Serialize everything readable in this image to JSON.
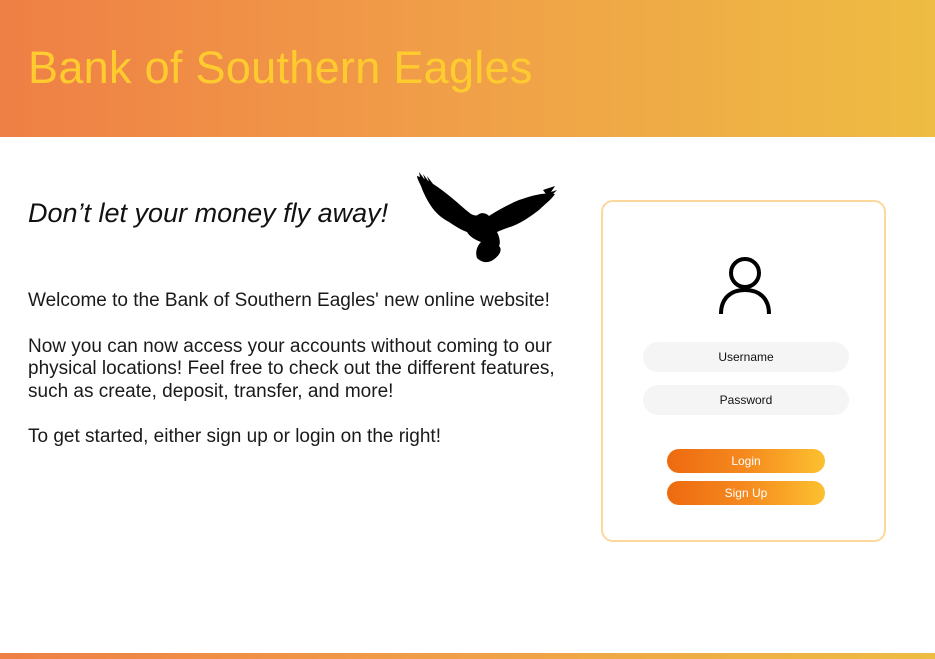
{
  "header": {
    "title": "Bank of Southern Eagles"
  },
  "hero": {
    "tagline": "Don’t let your money fly away!",
    "image_icon": "eagle-silhouette"
  },
  "intro": {
    "paragraphs": [
      "Welcome to the Bank of Southern Eagles' new online website!",
      "Now you can now access your accounts without coming to our physical locations! Feel free to check out the different features, such as create, deposit, transfer, and more!",
      "To get started, either sign up or login on the right!"
    ]
  },
  "login": {
    "avatar_icon": "user-icon",
    "username_placeholder": "Username",
    "password_placeholder": "Password",
    "login_label": "Login",
    "signup_label": "Sign Up"
  },
  "colors": {
    "header_gradient_start": "#ef7f45",
    "header_gradient_end": "#eebc42",
    "title_color": "#ffcb2e",
    "card_border": "#fcd89c",
    "button_gradient_start": "#ee6a10",
    "button_gradient_end": "#fcc030"
  }
}
